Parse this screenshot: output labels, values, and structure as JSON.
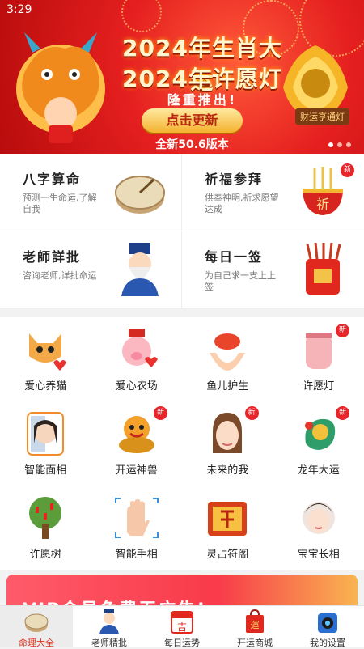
{
  "status_bar": {
    "time": "3:29"
  },
  "banner": {
    "title_line1": "2024年生肖大运",
    "title_line2": "2024年许愿灯",
    "subtitle": "隆重推出!",
    "button": "点击更新",
    "version": "全新50.6版本",
    "lamp_label": "财运亨通灯"
  },
  "feature_cards": [
    {
      "title": "八字算命",
      "desc": "预测一生命运,了解自我",
      "icon": "sundial-icon",
      "new": ""
    },
    {
      "title": "祈福参拜",
      "desc": "供奉神明,祈求愿望达成",
      "icon": "incense-burner-icon",
      "new": "新",
      "emblem": "祈"
    },
    {
      "title": "老師詳批",
      "desc": "咨询老师,详批命运",
      "icon": "old-master-icon",
      "new": ""
    },
    {
      "title": "每日一签",
      "desc": "为自己求一支上上签",
      "icon": "fortune-sticks-icon",
      "new": ""
    }
  ],
  "grid_items": [
    {
      "label": "爱心养猫",
      "icon": "cat-icon",
      "new": ""
    },
    {
      "label": "爱心农场",
      "icon": "pig-icon",
      "new": ""
    },
    {
      "label": "鱼儿护生",
      "icon": "fish-hands-icon",
      "new": ""
    },
    {
      "label": "许愿灯",
      "icon": "lantern-icon",
      "new": "新"
    },
    {
      "label": "智能面相",
      "icon": "face-reading-icon",
      "new": ""
    },
    {
      "label": "开运神兽",
      "icon": "lion-icon",
      "new": "新"
    },
    {
      "label": "未来的我",
      "icon": "future-face-icon",
      "new": "新"
    },
    {
      "label": "龙年大运",
      "icon": "dragon-icon",
      "new": "新"
    },
    {
      "label": "许愿树",
      "icon": "wish-tree-icon",
      "new": ""
    },
    {
      "label": "智能手相",
      "icon": "palm-icon",
      "new": ""
    },
    {
      "label": "灵占符阁",
      "icon": "talisman-icon",
      "new": ""
    },
    {
      "label": "宝宝长相",
      "icon": "baby-face-icon",
      "new": ""
    }
  ],
  "vip_banner": {
    "text": "VIP会员免费无广告!"
  },
  "tabs": [
    {
      "label": "命理大全",
      "icon": "compass-icon",
      "active": true
    },
    {
      "label": "老师精批",
      "icon": "master-icon",
      "active": false
    },
    {
      "label": "每日运势",
      "icon": "calendar-icon",
      "active": false,
      "emblem": "吉"
    },
    {
      "label": "开运商城",
      "icon": "shopping-bag-icon",
      "active": false,
      "emblem": "運"
    },
    {
      "label": "我的设置",
      "icon": "robot-icon",
      "active": false
    }
  ],
  "colors": {
    "primary_red": "#e51f1f",
    "accent_gold": "#f4b22f",
    "active_tab_text": "#e0331f"
  }
}
